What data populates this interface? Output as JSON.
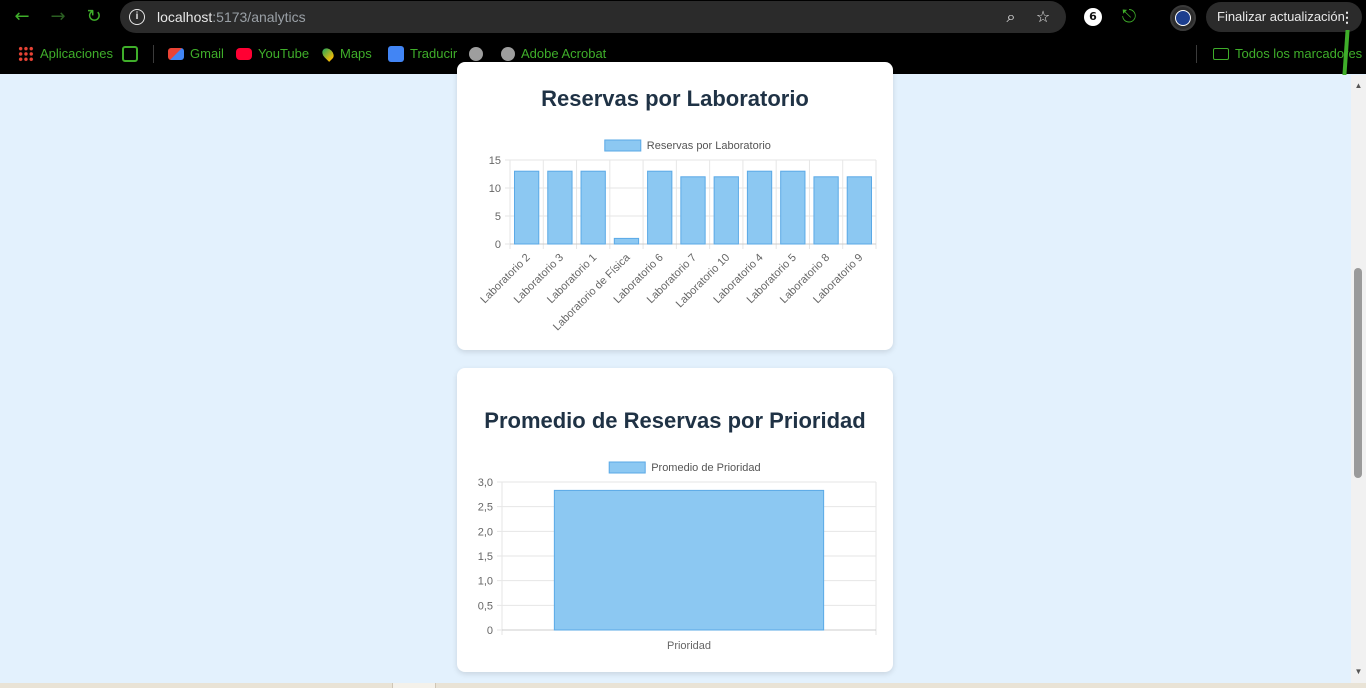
{
  "browser": {
    "url_host": "localhost",
    "url_path": ":5173/analytics",
    "update_button": "Finalizar actualización",
    "profile_badge": "6"
  },
  "bookmarks": [
    {
      "label": "Aplicaciones",
      "icon": "apps-grid-icon"
    },
    {
      "label": "Gmail",
      "icon": "gmail-icon"
    },
    {
      "label": "YouTube",
      "icon": "youtube-icon"
    },
    {
      "label": "Maps",
      "icon": "maps-icon"
    },
    {
      "label": "Traducir",
      "icon": "translate-icon"
    },
    {
      "label": "Adobe Acrobat",
      "icon": "globe-icon"
    }
  ],
  "bookmarks_folder": "Todos los marcadores",
  "colors": {
    "bar_fill": "#8cc8f2",
    "bar_stroke": "#5aa9e6",
    "title": "#1f3245",
    "page_bg": "#e3f1fd",
    "accent": "#3fae2a"
  },
  "cards": [
    {
      "title": "Reservas por Laboratorio",
      "chart_data": {
        "type": "bar",
        "categories": [
          "Laboratorio 2",
          "Laboratorio 3",
          "Laboratorio 1",
          "Laboratorio de Física",
          "Laboratorio 6",
          "Laboratorio 7",
          "Laboratorio 10",
          "Laboratorio 4",
          "Laboratorio 5",
          "Laboratorio 8",
          "Laboratorio 9"
        ],
        "series": [
          {
            "name": "Reservas por Laboratorio",
            "values": [
              13,
              13,
              13,
              1,
              13,
              12,
              12,
              13,
              13,
              12,
              12
            ]
          }
        ],
        "yticks": [
          "0",
          "5",
          "10",
          "15"
        ],
        "ylim": [
          0,
          15
        ],
        "legend": "top",
        "grid": true
      }
    },
    {
      "title": "Promedio de Reservas por Prioridad",
      "chart_data": {
        "type": "bar",
        "categories": [
          "Prioridad"
        ],
        "series": [
          {
            "name": "Promedio de Prioridad",
            "values": [
              2.83
            ]
          }
        ],
        "yticks": [
          "0",
          "0,5",
          "1,0",
          "1,5",
          "2,0",
          "2,5",
          "3,0"
        ],
        "ylim": [
          0,
          3
        ],
        "legend": "top",
        "grid": true
      }
    }
  ]
}
